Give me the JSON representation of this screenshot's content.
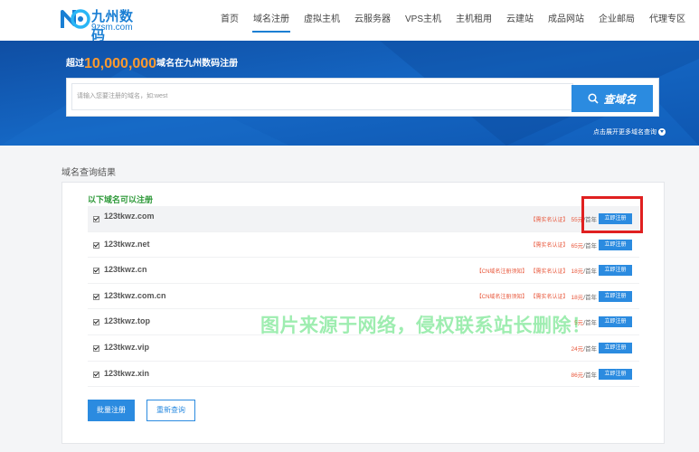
{
  "logo": {
    "cn": "九州数码",
    "en": "9zsm.com"
  },
  "nav": [
    "首页",
    "域名注册",
    "虚拟主机",
    "云服务器",
    "VPS主机",
    "主机租用",
    "云建站",
    "成品网站",
    "企业邮局",
    "代理专区"
  ],
  "nav_active_index": 1,
  "banner": {
    "prefix": "超过",
    "count": "10,000,000",
    "suffix": "域名在九州数码注册",
    "search_placeholder": "请输入您要注册的域名，如:west",
    "search_button": "查域名",
    "more_link": "点击展开更多域名查询"
  },
  "results": {
    "section_title": "域名查询结果",
    "available_title": "以下域名可以注册",
    "unit": "/首年",
    "register_label": "立即注册",
    "rows": [
      {
        "name": "123tkwz.com",
        "tags": [
          "【需实名认证】"
        ],
        "price": "55元"
      },
      {
        "name": "123tkwz.net",
        "tags": [
          "【需实名认证】"
        ],
        "price": "65元"
      },
      {
        "name": "123tkwz.cn",
        "tags": [
          "【CN域名注册须知】",
          "【需实名认证】"
        ],
        "price": "18元"
      },
      {
        "name": "123tkwz.com.cn",
        "tags": [
          "【CN域名注册须知】",
          "【需实名认证】"
        ],
        "price": "18元"
      },
      {
        "name": "123tkwz.top",
        "tags": [],
        "price": "5元"
      },
      {
        "name": "123tkwz.vip",
        "tags": [],
        "price": "24元"
      },
      {
        "name": "123tkwz.xin",
        "tags": [],
        "price": "86元"
      }
    ],
    "bulk_register": "批量注册",
    "requery": "重新查询"
  },
  "watermark": "图片来源于网络，侵权联系站长删除！",
  "colors": {
    "primary": "#2b8be0",
    "banner": "#1360b5",
    "accent": "#ff9a2e",
    "price": "#e8563a",
    "highlight": "#e02020"
  }
}
